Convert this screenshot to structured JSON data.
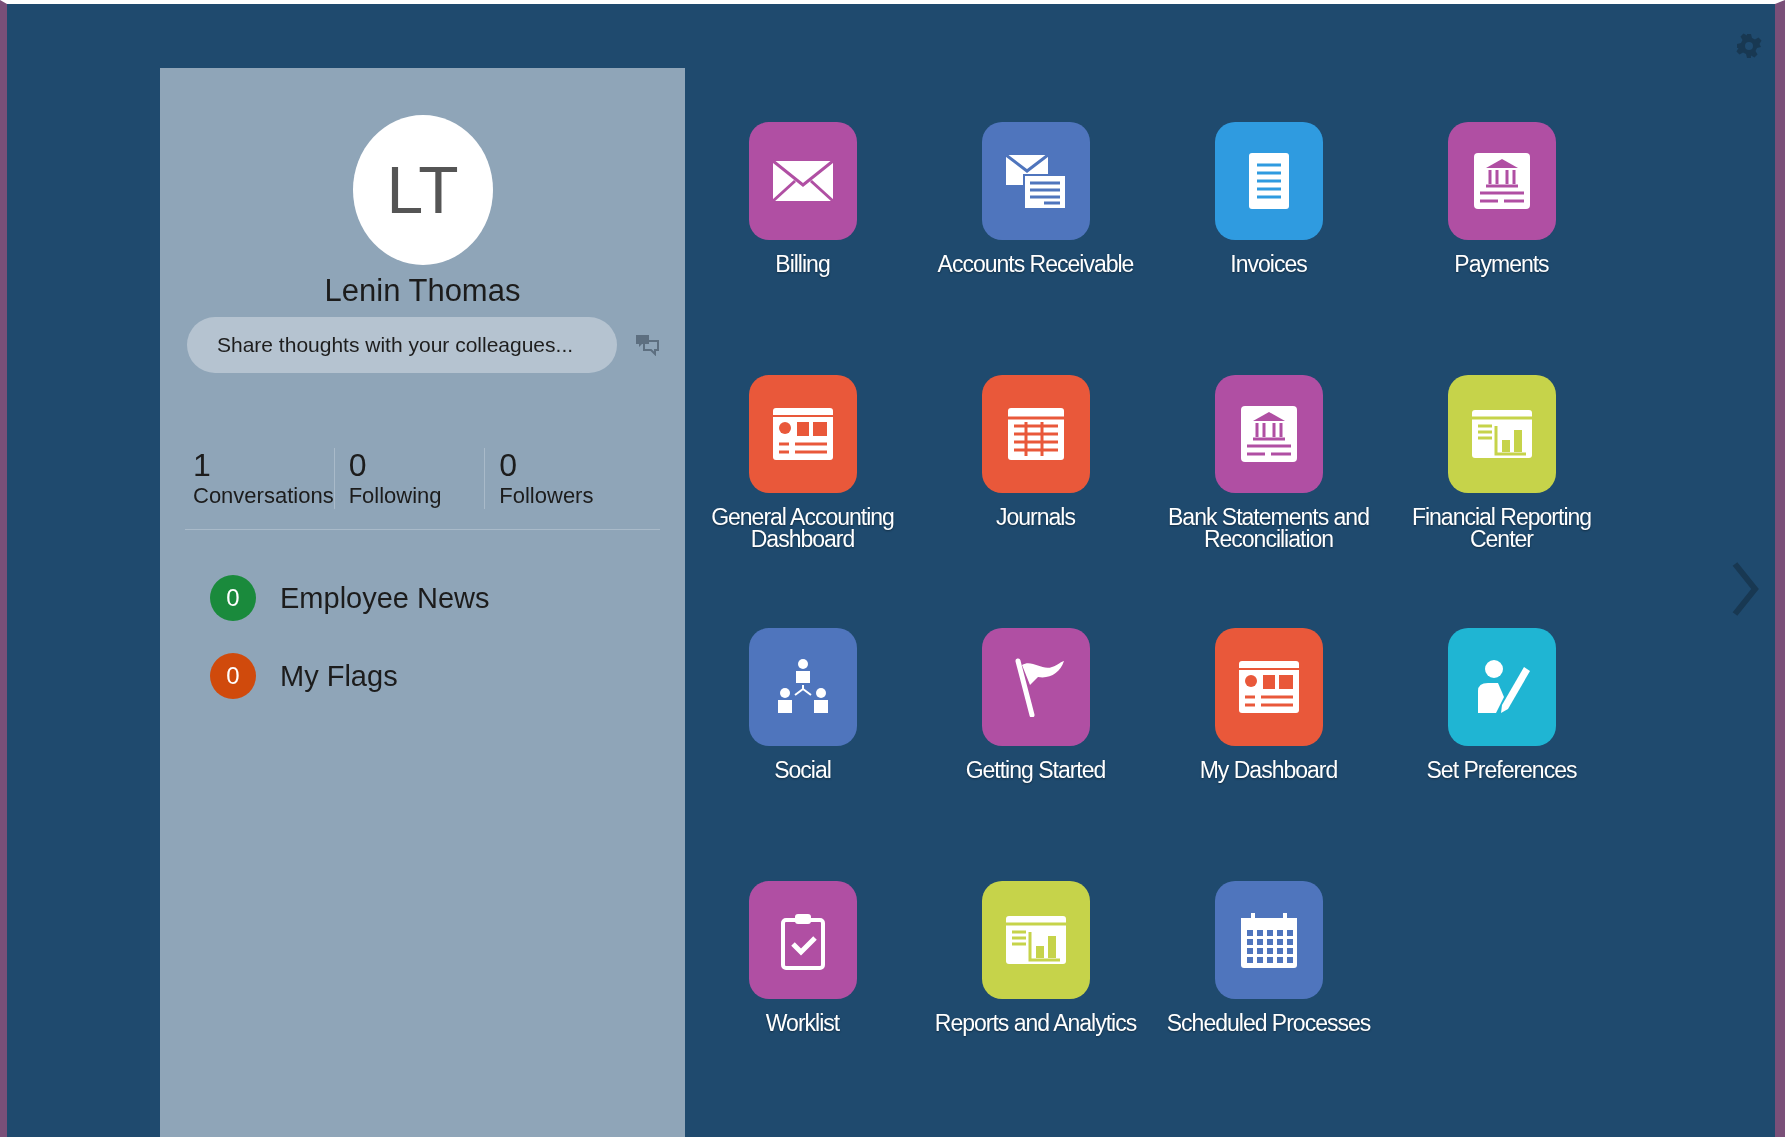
{
  "profile": {
    "initials": "LT",
    "name": "Lenin Thomas",
    "share_placeholder": "Share thoughts with your colleagues..."
  },
  "stats": [
    {
      "count": "1",
      "label": "Conversations"
    },
    {
      "count": "0",
      "label": "Following"
    },
    {
      "count": "0",
      "label": "Followers"
    }
  ],
  "feeds": [
    {
      "count": "0",
      "label": "Employee News",
      "color": "#1a8a3c"
    },
    {
      "count": "0",
      "label": "My Flags",
      "color": "#d04a0c"
    }
  ],
  "apps": [
    {
      "label": "Billing",
      "color": "#b04fa3"
    },
    {
      "label": "Accounts Receivable",
      "color": "#4f75bd"
    },
    {
      "label": "Invoices",
      "color": "#2f9be0"
    },
    {
      "label": "Payments",
      "color": "#b04fa3"
    },
    {
      "label": "General Accounting Dashboard",
      "color": "#e9583a"
    },
    {
      "label": "Journals",
      "color": "#e9583a"
    },
    {
      "label": "Bank Statements and Reconciliation",
      "color": "#b04fa3"
    },
    {
      "label": "Financial Reporting Center",
      "color": "#c6d34a"
    },
    {
      "label": "Social",
      "color": "#4f75bd"
    },
    {
      "label": "Getting Started",
      "color": "#b04fa3"
    },
    {
      "label": "My Dashboard",
      "color": "#e9583a"
    },
    {
      "label": "Set Preferences",
      "color": "#1fb5d3"
    },
    {
      "label": "Worklist",
      "color": "#b04fa3"
    },
    {
      "label": "Reports and Analytics",
      "color": "#c6d34a"
    },
    {
      "label": "Scheduled Processes",
      "color": "#4f75bd"
    }
  ]
}
